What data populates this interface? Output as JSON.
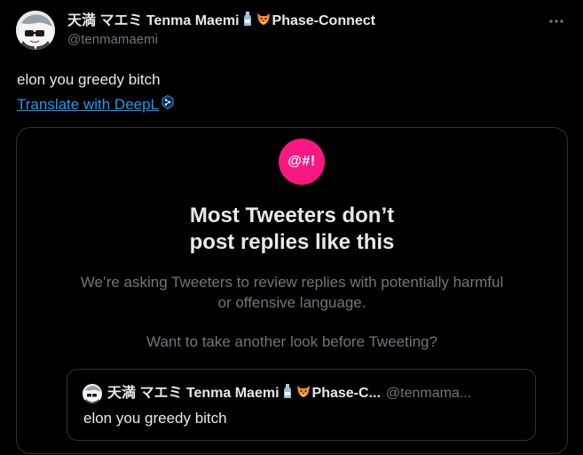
{
  "tweet": {
    "author": {
      "name_prefix": "天満 マエミ Tenma Maemi",
      "name_suffix": "Phase-Connect",
      "handle": "@tenmamaemi",
      "emoji_1": "bottle-emoji",
      "emoji_2": "fox-emoji"
    },
    "text": "elon you greedy bitch",
    "translate_label": "Translate with DeepL",
    "translate_icon": "deepl-icon",
    "more_icon": "more-dots-icon"
  },
  "warning": {
    "icon_text": "@#!",
    "icon_color": "#f91880",
    "title_line1": "Most Tweeters don’t",
    "title_line2": "post replies like this",
    "description_line1": "We’re asking Tweeters to review replies with potentially harmful",
    "description_line2": "or offensive language.",
    "question": "Want to take another look before Tweeting?"
  },
  "quote": {
    "name_prefix": "天満 マエミ Tenma Maemi",
    "name_suffix": "Phase-C...",
    "handle": "@tenmama...",
    "text": "elon you greedy bitch"
  },
  "colors": {
    "background": "#000000",
    "text": "#e7e9ea",
    "secondary": "#71767b",
    "link": "#1d9bf0",
    "border": "#2f3336"
  }
}
